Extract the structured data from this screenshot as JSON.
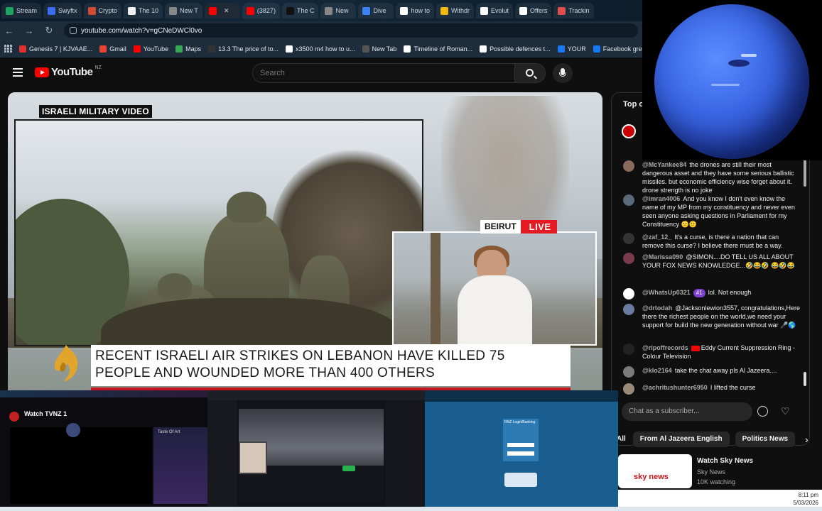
{
  "browser": {
    "tabs": [
      {
        "label": "Stream",
        "color": "#1da462",
        "active": false
      },
      {
        "label": "Swyftx",
        "color": "#3a6df0",
        "active": false
      },
      {
        "label": "Crypto",
        "color": "#d24b32",
        "active": false
      },
      {
        "label": "The 10",
        "color": "#f1f1f1",
        "active": false
      },
      {
        "label": "New T",
        "color": "#888888",
        "active": false
      },
      {
        "label": "",
        "color": "#ff0000",
        "active": true
      },
      {
        "label": "(3827)",
        "color": "#ff0000",
        "active": false
      },
      {
        "label": "The C",
        "color": "#111111",
        "active": false
      },
      {
        "label": "New",
        "color": "#888888",
        "active": false
      },
      {
        "label": "Dive",
        "color": "#3b82f6",
        "active": false
      },
      {
        "label": "how to",
        "color": "#ffffff",
        "active": false
      },
      {
        "label": "Withdr",
        "color": "#f0b90b",
        "active": false
      },
      {
        "label": "Evolut",
        "color": "#ffffff",
        "active": false
      },
      {
        "label": "Offers",
        "color": "#ffffff",
        "active": false
      },
      {
        "label": "Trackin",
        "color": "#e04d4d",
        "active": false
      }
    ],
    "url": "youtube.com/watch?v=gCNeDWCl0vo",
    "bookmarks": [
      {
        "label": "Genesis 7 | KJVAAE...",
        "color": "#e03030"
      },
      {
        "label": "Gmail",
        "color": "#ea4335"
      },
      {
        "label": "YouTube",
        "color": "#ff0000"
      },
      {
        "label": "Maps",
        "color": "#34a853"
      },
      {
        "label": "13.3 The price of to...",
        "color": "#333333"
      },
      {
        "label": "x3500 m4 how to u...",
        "color": "#ffffff"
      },
      {
        "label": "New Tab",
        "color": "#555555"
      },
      {
        "label": "Timeline of Roman...",
        "color": "#ffffff"
      },
      {
        "label": "Possible defences t...",
        "color": "#ffffff"
      },
      {
        "label": "YOUR",
        "color": "#1877f2"
      },
      {
        "label": "Facebook green",
        "color": "#1877f2"
      }
    ]
  },
  "youtube": {
    "logo_text": "YouTube",
    "region": "NZ",
    "search_placeholder": "Search"
  },
  "video": {
    "military_label": "ISRAELI MILITARY VIDEO",
    "city": "BEIRUT",
    "live": "LIVE",
    "headline_line1": "RECENT ISRAELI AIR STRIKES ON LEBANON HAVE KILLED 75",
    "headline_line2": "PEOPLE AND WOUNDED MORE THAN 400 OTHERS"
  },
  "chat": {
    "title": "Top c",
    "messages": [
      {
        "author": "@McYankee84",
        "text": "the drones are still their most dangerous asset and they have some serious ballistic missiles. but economic efficiency wise forget about it. drone strength is no joke",
        "avatar": "#8a6a5a"
      },
      {
        "author": "@imran4006",
        "text": "And you know I don't even know the name of my MP from my constituency and never even seen anyone asking questions in Parliament for my Constituency 😕😕",
        "avatar": "#5a6a7a"
      },
      {
        "author": "@zaf_12_",
        "text": "It's a curse, is there a nation that can remove this curse? I believe there must be a way.",
        "avatar": "#333333"
      },
      {
        "author": "@Marissa090",
        "text": "@SIMON....DO TELL US ALL ABOUT YOUR FOX NEWS KNOWLEDGE...🤣😂🤣 😂🤣😂",
        "avatar": "#7a3a4a"
      },
      {
        "author": "@WhatsUp0321",
        "badge": "#1",
        "text": "lol. Not enough",
        "avatar": "#ffffff"
      },
      {
        "author": "@drtodah",
        "text": "@Jacksonlewion3557, congratulations,Here there the richest people on the world,we need your support for build the new generation without war 🎤🌎",
        "avatar": "#6a7aa0"
      },
      {
        "author": "@ripoffrecords",
        "text": "Eddy Current Suppression Ring - Colour Television",
        "avatar": "#222222"
      },
      {
        "author": "@klo2164",
        "text": "take the chat away pls Al Jazeera....",
        "avatar": "#7a7a7a"
      },
      {
        "author": "@achritushunter6950",
        "text": "I lifted the curse",
        "avatar": "#9a8a7a"
      }
    ],
    "input_placeholder": "Chat as a subscriber..."
  },
  "chips": [
    "All",
    "From Al Jazeera English",
    "Politics News"
  ],
  "recommendation": {
    "title": "Watch Sky News",
    "channel": "Sky News",
    "watching": "10K watching",
    "thumb_logo": "sky news"
  },
  "bottom_windows": {
    "tvnz_title": "Watch TVNZ 1",
    "tvnz_side": "Taste Of Art",
    "login_title": "RNZ Login/Banking"
  },
  "clock": {
    "time": "8:11 pm",
    "date": "5/03/2026"
  }
}
